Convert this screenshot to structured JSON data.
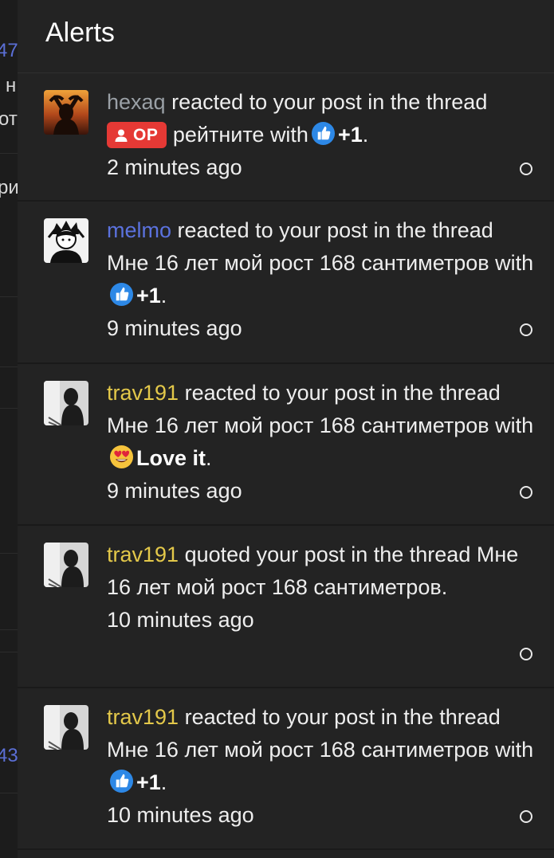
{
  "panel": {
    "title": "Alerts"
  },
  "background_fragments": [
    "47",
    "н",
    "от",
    "ри",
    "43"
  ],
  "alerts": [
    {
      "user": "hexaq",
      "action": "reacted to your post in the thread",
      "badge": "OP",
      "thread": "рейтните",
      "with": "with",
      "reaction_icon": "thumbs-up-icon",
      "reaction": "+1",
      "period": ".",
      "time": "2 minutes ago"
    },
    {
      "user": "melmo",
      "action": "reacted to your post in the thread",
      "thread": "Мне 16 лет мой рост 168 сантиметров",
      "with": "with",
      "reaction_icon": "thumbs-up-icon",
      "reaction": "+1",
      "period": ".",
      "time": "9 minutes ago"
    },
    {
      "user": "trav191",
      "action": "reacted to your post in the thread",
      "thread": "Мне 16 лет мой рост 168 сантиметров",
      "with": "with",
      "reaction_icon": "heart-eyes-icon",
      "reaction": "Love it",
      "period": ".",
      "time": "9 minutes ago"
    },
    {
      "user": "trav191",
      "action": "quoted your post in the thread",
      "thread": "Мне 16 лет мой рост 168 сантиметров",
      "period": ".",
      "time": "10 minutes ago"
    },
    {
      "user": "trav191",
      "action": "reacted to your post in the thread",
      "thread": "Мне 16 лет мой рост 168 сантиметров",
      "with": "with",
      "reaction_icon": "thumbs-up-icon",
      "reaction": "+1",
      "period": ".",
      "time": "10 minutes ago"
    }
  ],
  "colors": {
    "op_badge": "#e53935",
    "user_default": "#9aa0a6",
    "user_blue": "#5b72de",
    "user_gold": "#e3c84a",
    "like_blue": "#2d88e6"
  }
}
